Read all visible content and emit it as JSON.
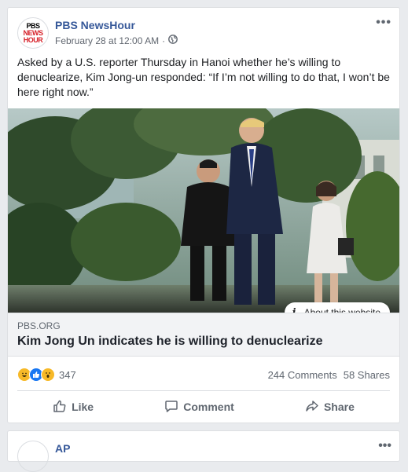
{
  "post": {
    "page_name": "PBS NewsHour",
    "avatar_lines": [
      "PBS",
      "NEWS",
      "HOUR"
    ],
    "timestamp": "February 28 at 12:00 AM",
    "separator": "·",
    "more": "•••",
    "text": "Asked by a U.S. reporter Thursday in Hanoi whether he’s willing to denuclearize, Kim Jong-un responded: “If I’m not willing to do that, I won’t be here right now.”",
    "about_label": "About this website",
    "about_icon": "i",
    "link": {
      "domain": "PBS.ORG",
      "headline": "Kim Jong Un indicates he is willing to denuclearize"
    },
    "reaction_count": "347",
    "comments": "244 Comments",
    "shares": "58 Shares",
    "actions": {
      "like": "Like",
      "comment": "Comment",
      "share": "Share"
    }
  },
  "next_post": {
    "page_name": "AP",
    "more": "•••"
  },
  "colors": {
    "page_bg": "#e9ebee",
    "link_blue": "#365899",
    "like_blue": "#1877f2",
    "reaction_yellow": "#f7b928"
  }
}
